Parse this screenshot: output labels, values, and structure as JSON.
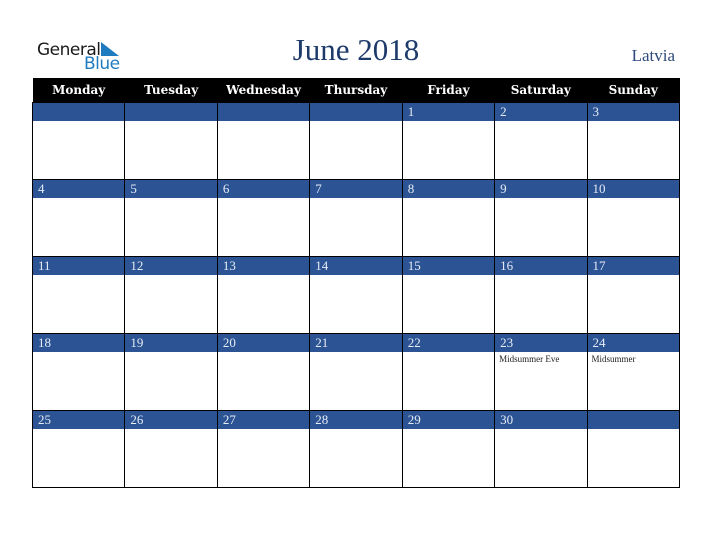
{
  "logo": {
    "word1": "General",
    "word2": "Blue",
    "icon": "triangle-flag-icon"
  },
  "title": "June 2018",
  "country": "Latvia",
  "colors": {
    "header_bg": "#000000",
    "day_bar": "#2c5494",
    "title": "#1e3a6a",
    "logo_blue": "#1f7bc0"
  },
  "weekdays": [
    "Monday",
    "Tuesday",
    "Wednesday",
    "Thursday",
    "Friday",
    "Saturday",
    "Sunday"
  ],
  "weeks": [
    [
      {
        "day": "",
        "event": ""
      },
      {
        "day": "",
        "event": ""
      },
      {
        "day": "",
        "event": ""
      },
      {
        "day": "",
        "event": ""
      },
      {
        "day": "1",
        "event": ""
      },
      {
        "day": "2",
        "event": ""
      },
      {
        "day": "3",
        "event": ""
      }
    ],
    [
      {
        "day": "4",
        "event": ""
      },
      {
        "day": "5",
        "event": ""
      },
      {
        "day": "6",
        "event": ""
      },
      {
        "day": "7",
        "event": ""
      },
      {
        "day": "8",
        "event": ""
      },
      {
        "day": "9",
        "event": ""
      },
      {
        "day": "10",
        "event": ""
      }
    ],
    [
      {
        "day": "11",
        "event": ""
      },
      {
        "day": "12",
        "event": ""
      },
      {
        "day": "13",
        "event": ""
      },
      {
        "day": "14",
        "event": ""
      },
      {
        "day": "15",
        "event": ""
      },
      {
        "day": "16",
        "event": ""
      },
      {
        "day": "17",
        "event": ""
      }
    ],
    [
      {
        "day": "18",
        "event": ""
      },
      {
        "day": "19",
        "event": ""
      },
      {
        "day": "20",
        "event": ""
      },
      {
        "day": "21",
        "event": ""
      },
      {
        "day": "22",
        "event": ""
      },
      {
        "day": "23",
        "event": "Midsummer Eve"
      },
      {
        "day": "24",
        "event": "Midsummer"
      }
    ],
    [
      {
        "day": "25",
        "event": ""
      },
      {
        "day": "26",
        "event": ""
      },
      {
        "day": "27",
        "event": ""
      },
      {
        "day": "28",
        "event": ""
      },
      {
        "day": "29",
        "event": ""
      },
      {
        "day": "30",
        "event": ""
      },
      {
        "day": "",
        "event": ""
      }
    ]
  ]
}
